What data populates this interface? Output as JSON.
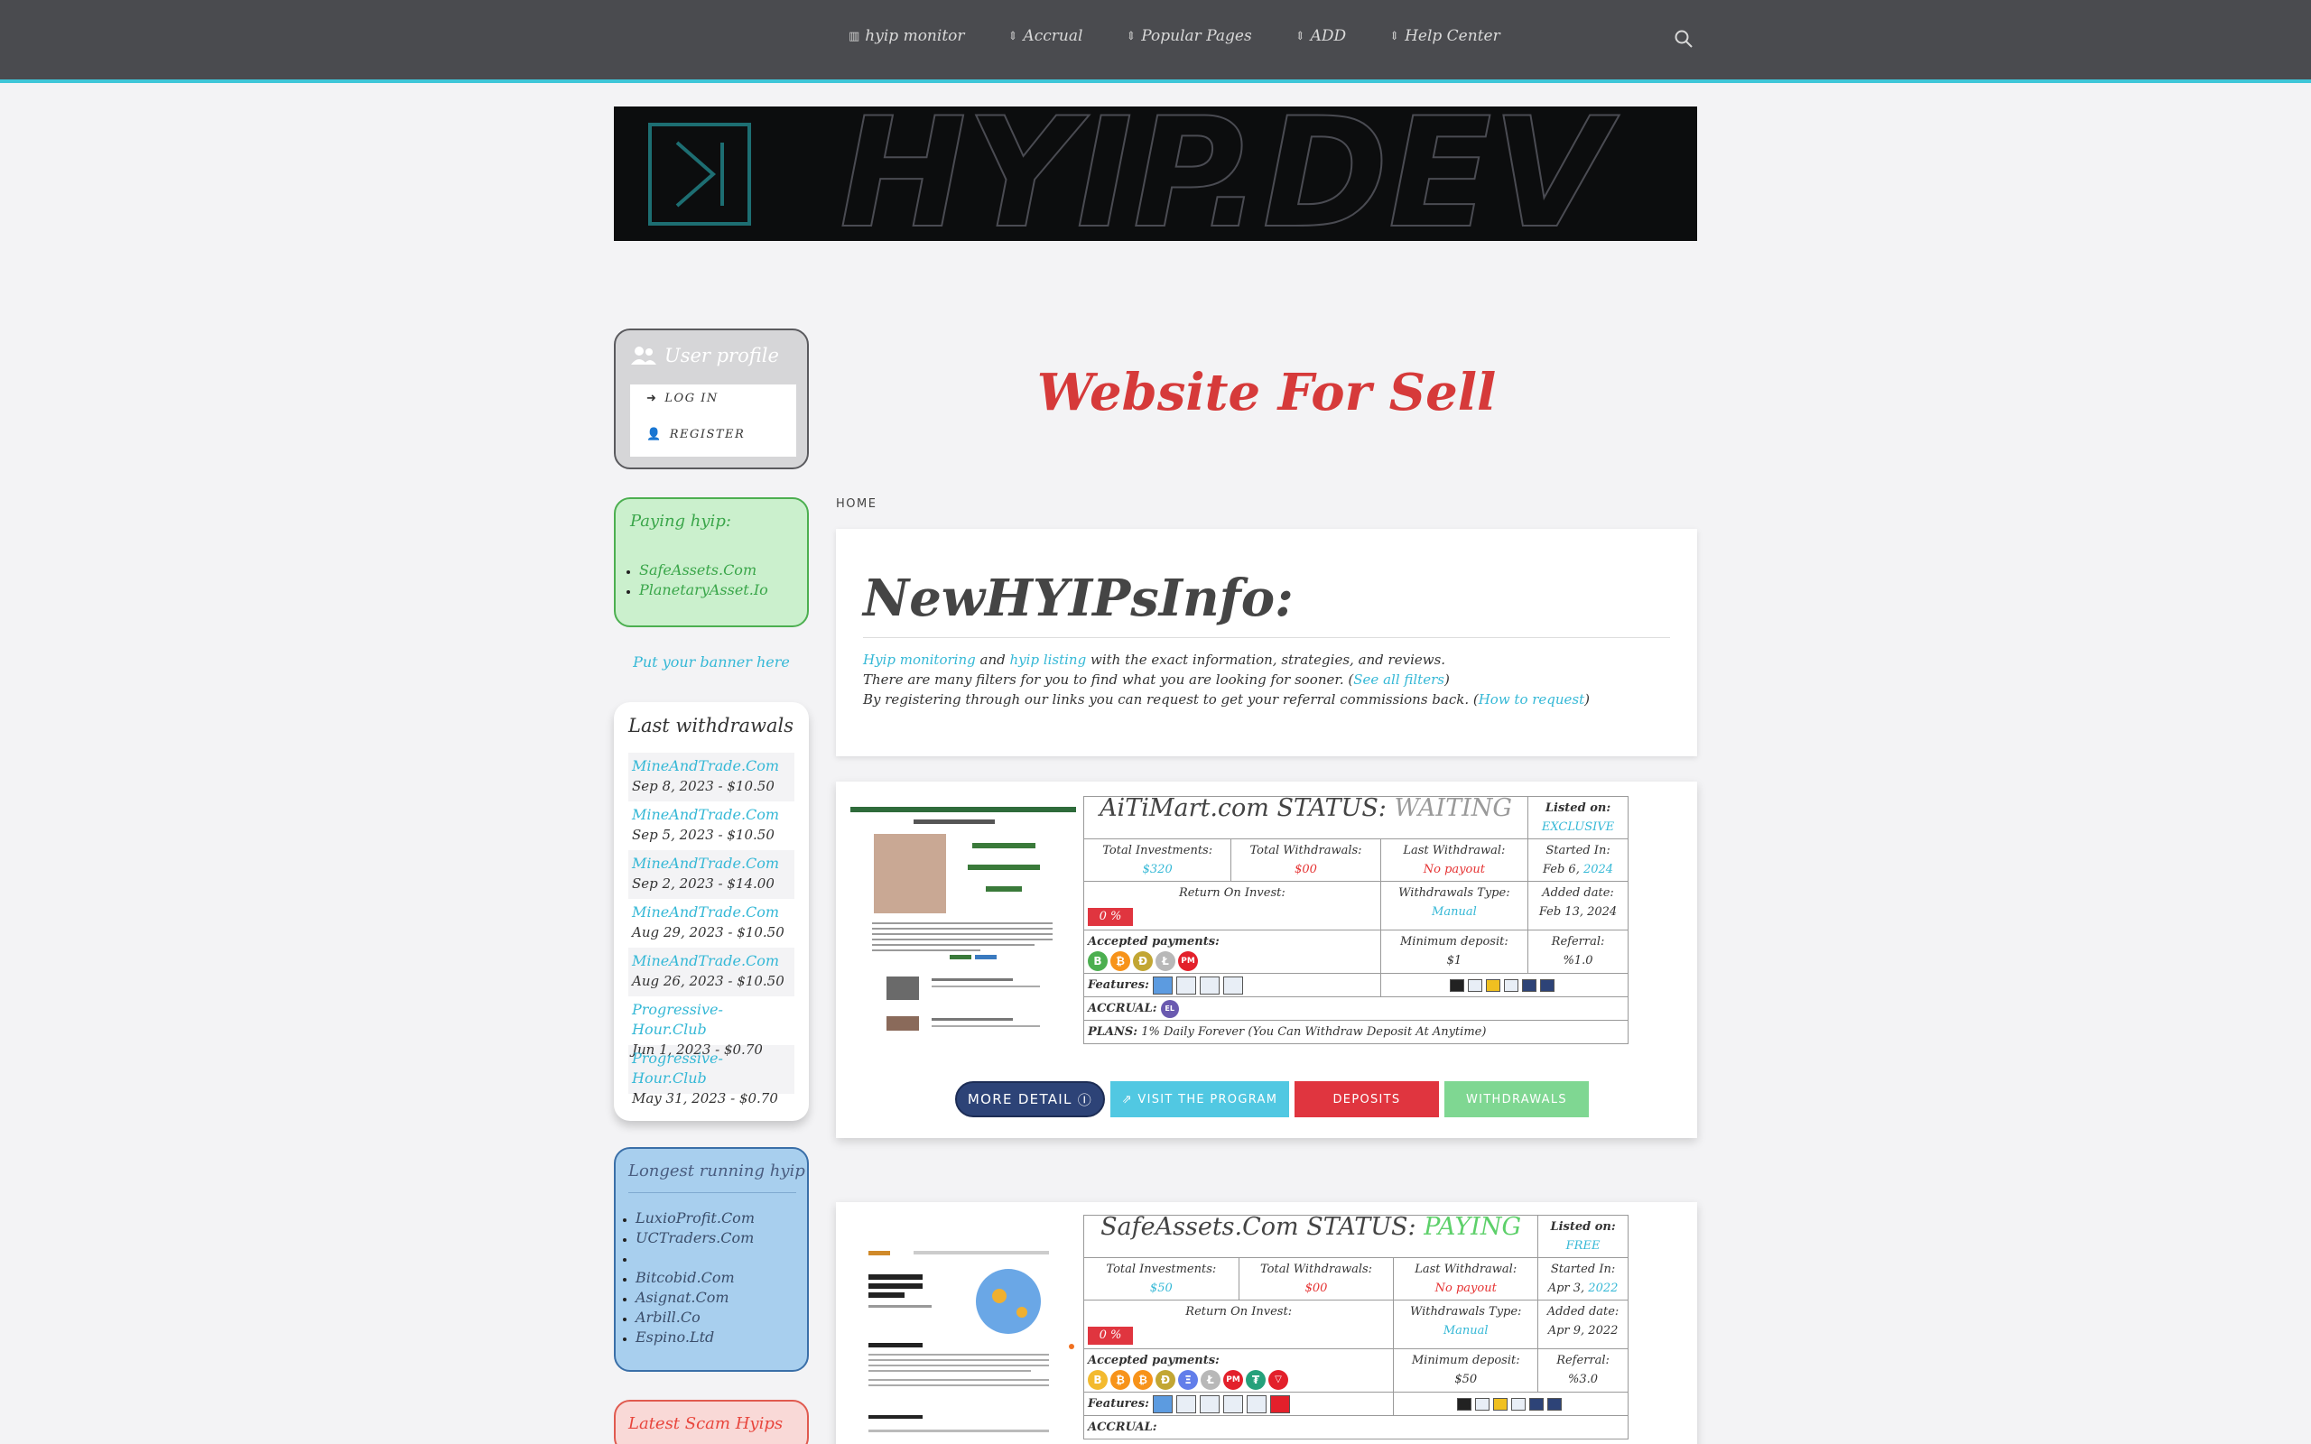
{
  "nav": {
    "items": [
      {
        "icon": "bar-chart-icon",
        "label": "hyip monitor"
      },
      {
        "icon": "sort-icon",
        "label": "Accrual"
      },
      {
        "icon": "sort-icon",
        "label": "Popular Pages"
      },
      {
        "icon": "sort-icon",
        "label": "ADD"
      },
      {
        "icon": "sort-icon",
        "label": "Help Center"
      }
    ]
  },
  "logo": {
    "text": "HYIP.DEV"
  },
  "user_profile": {
    "title": "User profile",
    "login": "LOG IN",
    "register": "REGISTER"
  },
  "paying": {
    "title": "Paying hyip:",
    "items": [
      "SafeAssets.Com",
      "PlanetaryAsset.Io"
    ]
  },
  "banner_ad": "Put your banner here",
  "last_withdrawals": {
    "title": "Last withdrawals",
    "items": [
      {
        "name": "MineAndTrade.Com",
        "detail": "Sep 8, 2023 - $10.50"
      },
      {
        "name": "MineAndTrade.Com",
        "detail": "Sep 5, 2023 - $10.50"
      },
      {
        "name": "MineAndTrade.Com",
        "detail": "Sep 2, 2023 - $14.00"
      },
      {
        "name": "MineAndTrade.Com",
        "detail": "Aug 29, 2023 - $10.50"
      },
      {
        "name": "MineAndTrade.Com",
        "detail": "Aug 26, 2023 - $10.50"
      },
      {
        "name": "Progressive-Hour.Club",
        "detail": "Jun 1, 2023 - $0.70"
      },
      {
        "name": "Progressive-Hour.Club",
        "detail": "May 31, 2023 - $0.70"
      }
    ]
  },
  "longest": {
    "title": "Longest running hyip",
    "items": [
      "LuxioProfit.Com",
      "UCTraders.Com",
      "",
      "Bitcobid.Com",
      "Asignat.Com",
      "Arbill.Co",
      "Espino.Ltd"
    ]
  },
  "scam": {
    "title": "Latest Scam Hyips"
  },
  "main": {
    "sell_title": "Website For Sell",
    "breadcrumb": "HOME",
    "heading": "NewHYIPsInfo:",
    "line1_link1": "Hyip monitoring",
    "line1_and": "and",
    "line1_link2": "hyip listing",
    "line1_rest": "with the exact information, strategies, and reviews.",
    "line2_text": "There are many filters for you to find what you are looking for sooner. (",
    "line2_link": "See all filters",
    "line2_end": ")",
    "line3_text": "By registering through our links you can request to get your referral commissions back. (",
    "line3_link": "How to request",
    "line3_end": ")"
  },
  "labels": {
    "status": "STATUS:",
    "listed_on": "Listed on:",
    "total_inv": "Total Investments:",
    "total_wd": "Total Withdrawals:",
    "last_wd": "Last Withdrawal:",
    "started": "Started In:",
    "roi": "Return On Invest:",
    "wd_type": "Withdrawals Type:",
    "added": "Added date:",
    "accepted": "Accepted payments:",
    "min_dep": "Minimum deposit:",
    "referral": "Referral:",
    "features": "Features:",
    "accrual": "ACCRUAL:",
    "plans": "PLANS:"
  },
  "listings": [
    {
      "name": "AiTiMart.com",
      "status": "WAITING",
      "listed": "EXCLUSIVE",
      "total_inv": "$320",
      "total_wd": "$00",
      "last_wd": "No payout",
      "started_md": "Feb 6,",
      "started_y": "2024",
      "roi": "0 %",
      "wd_type": "Manual",
      "added": "Feb 13, 2024",
      "min_dep": "$1",
      "referral": "%1.0",
      "plans": "1% Daily Forever (You Can Withdraw Deposit At Anytime)",
      "coins": [
        "bnb",
        "btc",
        "doge",
        "ltc",
        "pm"
      ]
    },
    {
      "name": "SafeAssets.Com",
      "status": "PAYING",
      "listed": "FREE",
      "total_inv": "$50",
      "total_wd": "$00",
      "last_wd": "No payout",
      "started_md": "Apr 3,",
      "started_y": "2022",
      "roi": "0 %",
      "wd_type": "Manual",
      "added": "Apr 9, 2022",
      "min_dep": "$50",
      "referral": "%3.0",
      "coins": [
        "bnb",
        "btc",
        "btc",
        "doge",
        "eth",
        "ltc",
        "pm",
        "usdt",
        "trx"
      ]
    }
  ],
  "buttons": {
    "more": "MORE DETAIL",
    "visit": "VISIT THE PROGRAM",
    "deposits": "DEPOSITS",
    "withdrawals": "WITHDRAWALS"
  },
  "colors": {
    "nav_bg": "#4a4b4f",
    "accent": "#35b8d6",
    "sell_red": "#d63a3a",
    "paying_green": "#5dd06a",
    "more_btn": "#2d4377"
  }
}
